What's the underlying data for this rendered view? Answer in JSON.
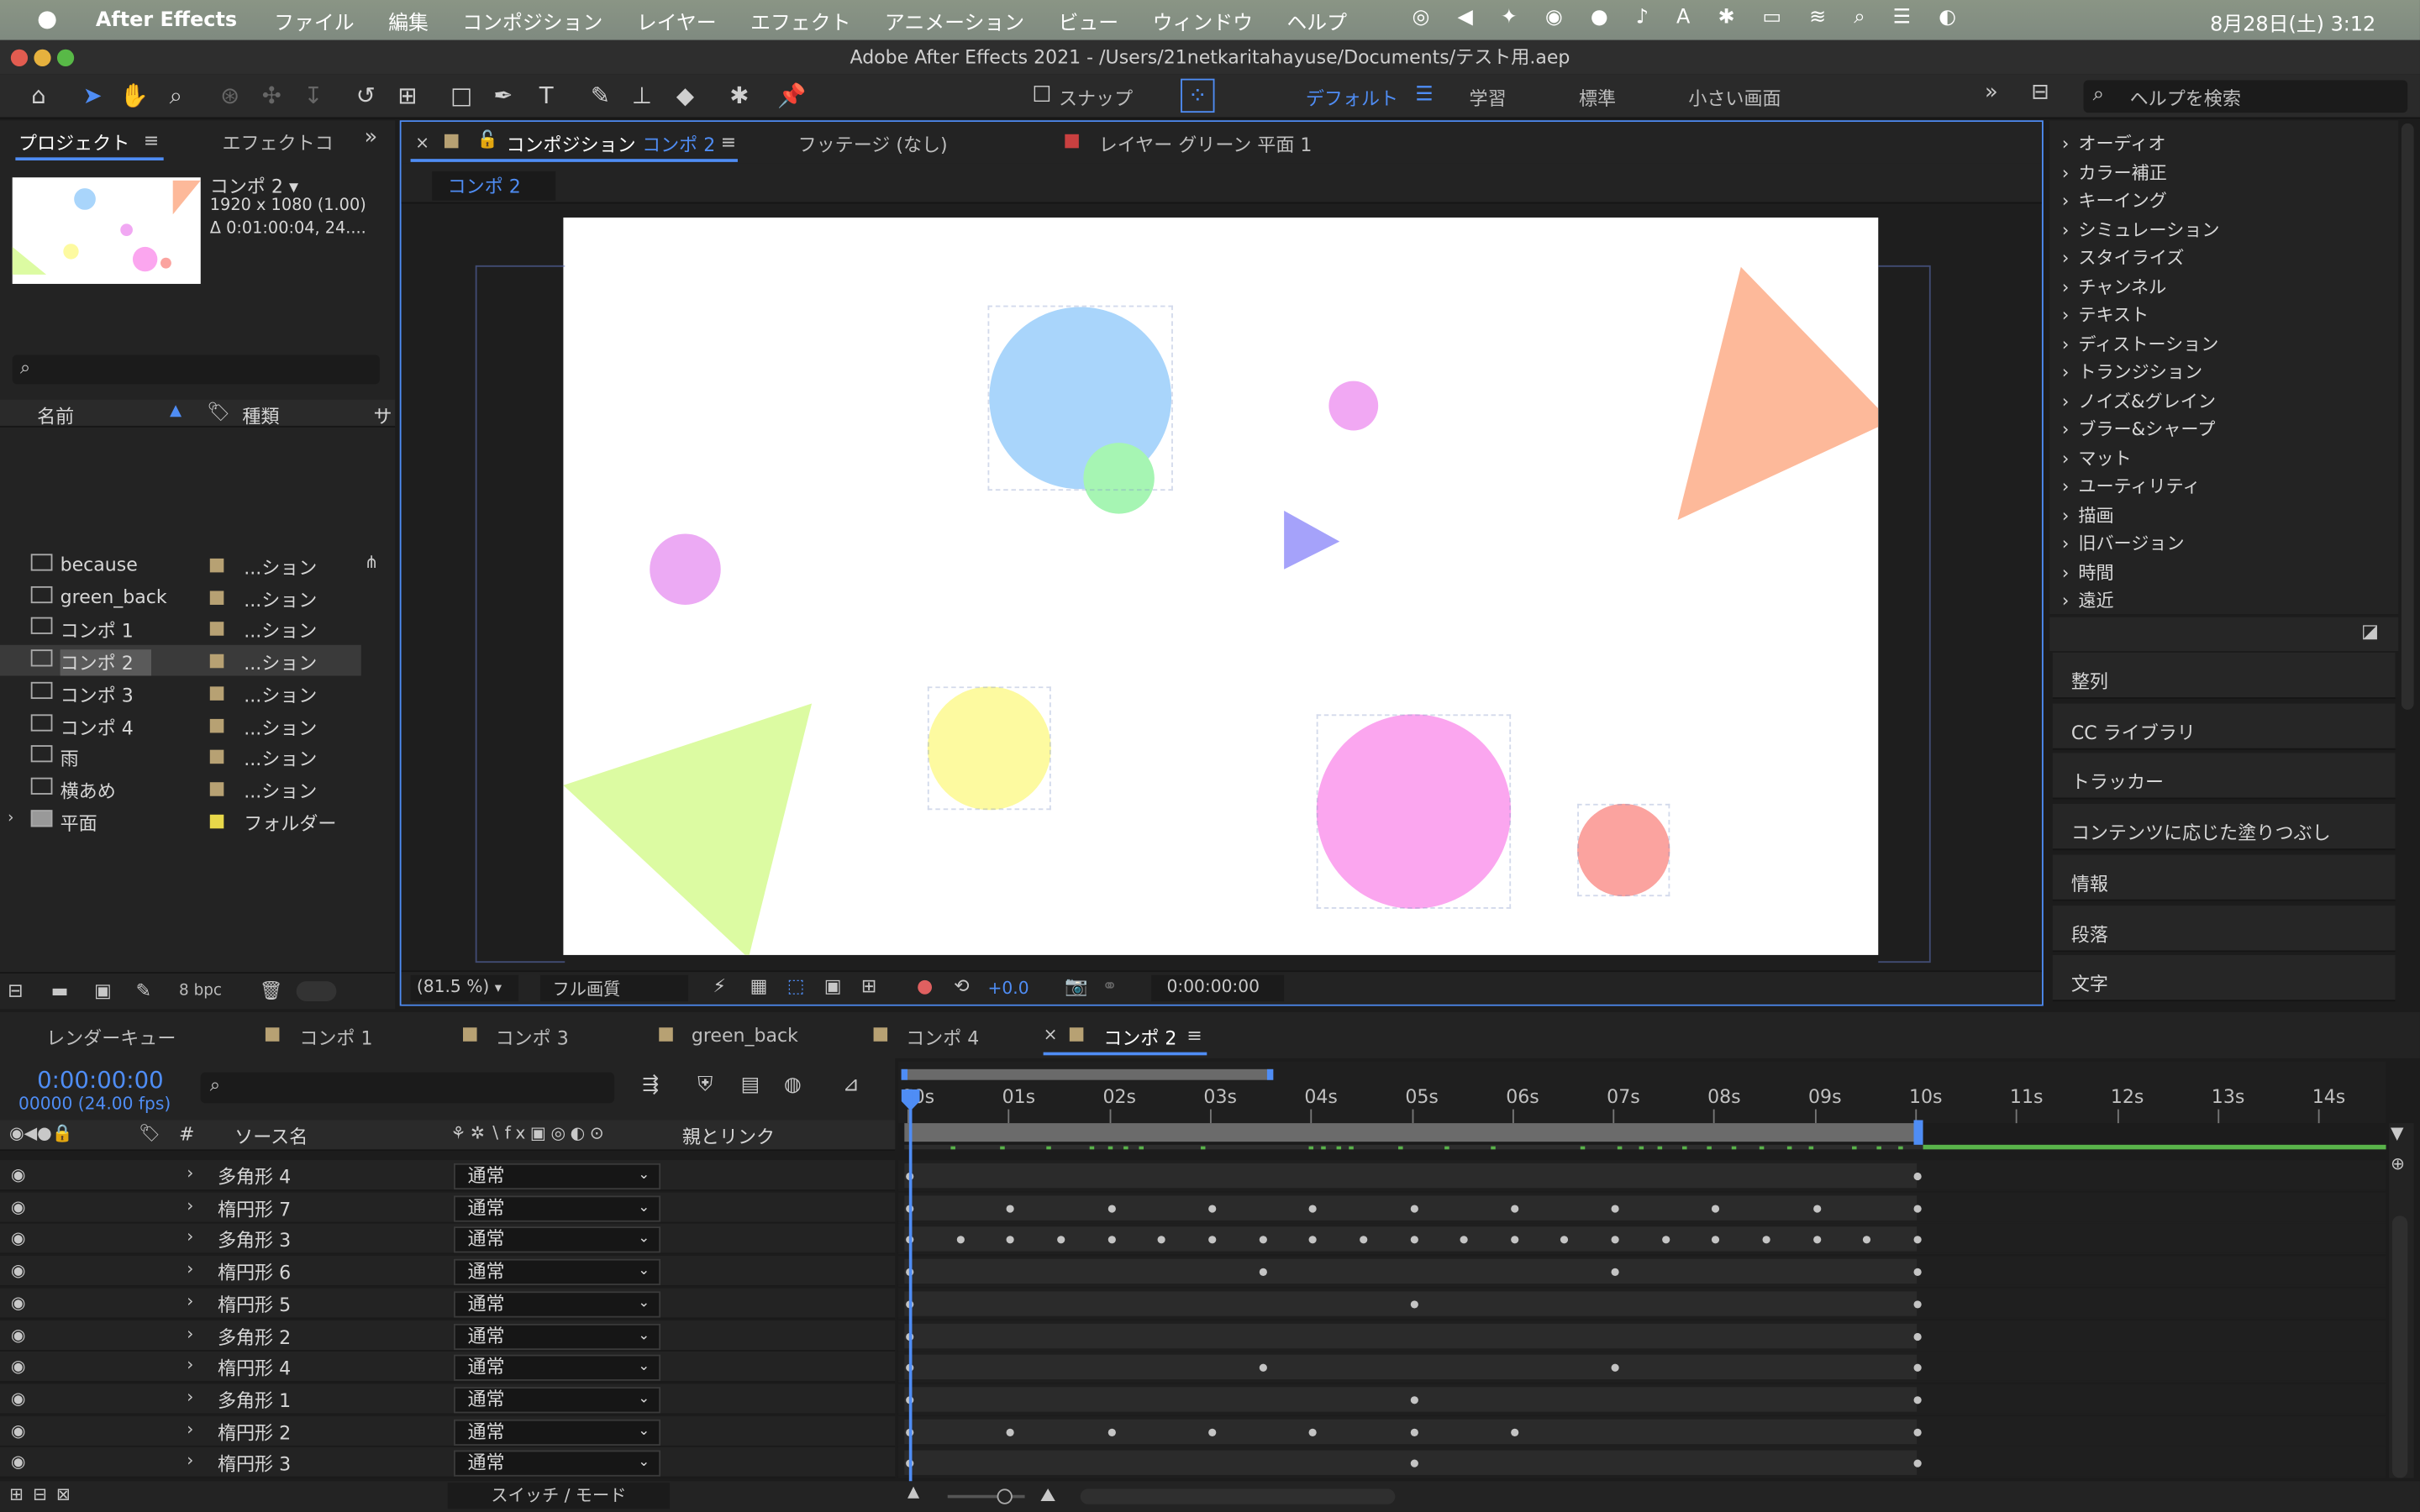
{
  "menubar": {
    "app": "After Effects",
    "items": [
      "ファイル",
      "編集",
      "コンポジション",
      "レイヤー",
      "エフェクト",
      "アニメーション",
      "ビュー",
      "ウィンドウ",
      "ヘルプ"
    ],
    "clock": "8月28日(土) 3:12"
  },
  "window": {
    "title": "Adobe After Effects 2021 - /Users/21netkaritahayuse/Documents/テスト用.aep"
  },
  "toolbar": {
    "snap_label": "スナップ",
    "workspaces": [
      "デフォルト",
      "学習",
      "標準",
      "小さい画面"
    ],
    "search_placeholder": "ヘルプを検索"
  },
  "project": {
    "tab_project": "プロジェクト",
    "tab_effects": "エフェクトコ",
    "comp_name": "コンポ 2 ▾",
    "comp_size": "1920 x 1080 (1.00)",
    "comp_duration": "Δ 0:01:00:04, 24....",
    "col_name": "名前",
    "col_type": "種類",
    "col_extra": "サ",
    "bpc": "8 bpc",
    "items": [
      {
        "name": "because",
        "type": "...ション"
      },
      {
        "name": "green_back",
        "type": "...ション"
      },
      {
        "name": "コンポ 1",
        "type": "...ション"
      },
      {
        "name": "コンポ 2",
        "type": "...ション"
      },
      {
        "name": "コンポ 3",
        "type": "...ション"
      },
      {
        "name": "コンポ 4",
        "type": "...ション"
      },
      {
        "name": "雨",
        "type": "...ション"
      },
      {
        "name": "横あめ",
        "type": "...ション"
      },
      {
        "name": "平面",
        "type": "フォルダー"
      }
    ]
  },
  "viewer": {
    "tab_comp_prefix": "コンポジション",
    "tab_comp_name": "コンポ 2",
    "tab_footage": "フッテージ (なし)",
    "tab_layer": "レイヤー グリーン 平面 1",
    "breadcrumb": "コンポ 2",
    "zoom": "(81.5 %)",
    "quality": "フル画質",
    "exposure": "+0.0",
    "timecode": "0:00:00:00"
  },
  "effects_list": [
    "オーディオ",
    "カラー補正",
    "キーイング",
    "シミュレーション",
    "スタイライズ",
    "チャンネル",
    "テキスト",
    "ディストーション",
    "トランジション",
    "ノイズ&グレイン",
    "ブラー&シャープ",
    "マット",
    "ユーティリティ",
    "描画",
    "旧バージョン",
    "時間",
    "遠近"
  ],
  "right_panels": [
    "整列",
    "CC ライブラリ",
    "トラッカー",
    "コンテンツに応じた塗りつぶし",
    "情報",
    "段落",
    "文字"
  ],
  "timeline": {
    "tabs": [
      "レンダーキュー",
      "コンポ 1",
      "コンポ 3",
      "green_back",
      "コンポ 4",
      "コンポ 2"
    ],
    "timecode": "0:00:00:00",
    "frames": "00000 (24.00 fps)",
    "col_hash": "#",
    "col_source": "ソース名",
    "col_parent": "親とリンク",
    "switch_mode": "スイッチ / モード",
    "ruler": [
      "00s",
      "01s",
      "02s",
      "03s",
      "04s",
      "05s",
      "06s",
      "07s",
      "08s",
      "09s",
      "10s",
      "11s",
      "12s",
      "13s",
      "14s"
    ],
    "layers": [
      {
        "name": "多角形 4",
        "mode": "通常",
        "keys": [
          0,
          10
        ]
      },
      {
        "name": "楕円形 7",
        "mode": "通常",
        "keys": [
          0,
          1,
          2,
          3,
          4,
          5,
          6,
          7,
          8,
          9,
          10
        ]
      },
      {
        "name": "多角形 3",
        "mode": "通常",
        "keys": [
          0,
          0.5,
          1,
          1.5,
          2,
          2.5,
          3,
          3.5,
          4,
          4.5,
          5,
          5.5,
          6,
          6.5,
          7,
          7.5,
          8,
          8.5,
          9,
          9.5,
          10
        ]
      },
      {
        "name": "楕円形 6",
        "mode": "通常",
        "keys": [
          0,
          3.5,
          7,
          10
        ]
      },
      {
        "name": "楕円形 5",
        "mode": "通常",
        "keys": [
          0,
          5,
          10
        ]
      },
      {
        "name": "多角形 2",
        "mode": "通常",
        "keys": [
          0,
          10
        ]
      },
      {
        "name": "楕円形 4",
        "mode": "通常",
        "keys": [
          0,
          3.5,
          7,
          10
        ]
      },
      {
        "name": "多角形 1",
        "mode": "通常",
        "keys": [
          0,
          5,
          10
        ]
      },
      {
        "name": "楕円形 2",
        "mode": "通常",
        "keys": [
          0,
          1,
          2,
          3,
          4,
          5,
          6,
          10
        ]
      },
      {
        "name": "楕円形 3",
        "mode": "通常",
        "keys": [
          0,
          5,
          10
        ]
      }
    ]
  },
  "colors": {
    "accent": "#4f8df5",
    "blue_circle": "#a9d5fb",
    "green_circle": "#a6f5b3",
    "pink_small": "#f1a8f3",
    "orange_tri": "#fdb99a",
    "purple_tri": "#a5a2fa",
    "lime_tri": "#dcfba2",
    "yellow": "#fdfaa0",
    "pink_big": "#fba6ef",
    "red": "#fba39f"
  }
}
